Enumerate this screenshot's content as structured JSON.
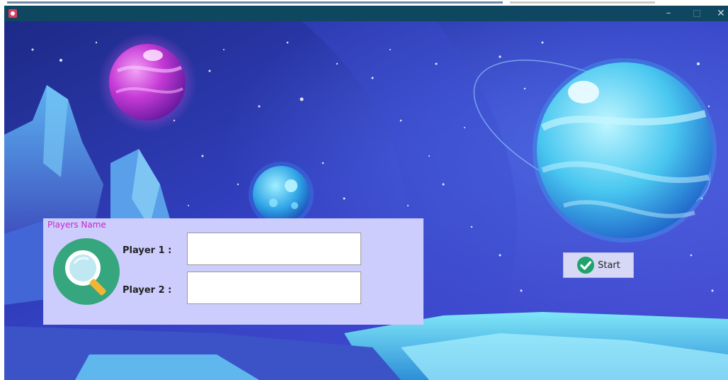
{
  "window": {
    "title": ""
  },
  "players_panel": {
    "title": "Players Name",
    "player1_label": "Player 1 :",
    "player2_label": "Player 2 :",
    "player1_value": "",
    "player2_value": ""
  },
  "start_button": {
    "label": "Start",
    "icon": "check-circle-icon"
  },
  "colors": {
    "titlebar": "#0f4760",
    "panel": "#cccdfd",
    "panel_title": "#cc22cc",
    "start_button": "#d7d8f6",
    "check": "#1fa36b"
  },
  "icons": [
    "app-icon",
    "minimize-icon",
    "maximize-icon",
    "close-icon",
    "magnifier-icon",
    "check-circle-icon"
  ]
}
